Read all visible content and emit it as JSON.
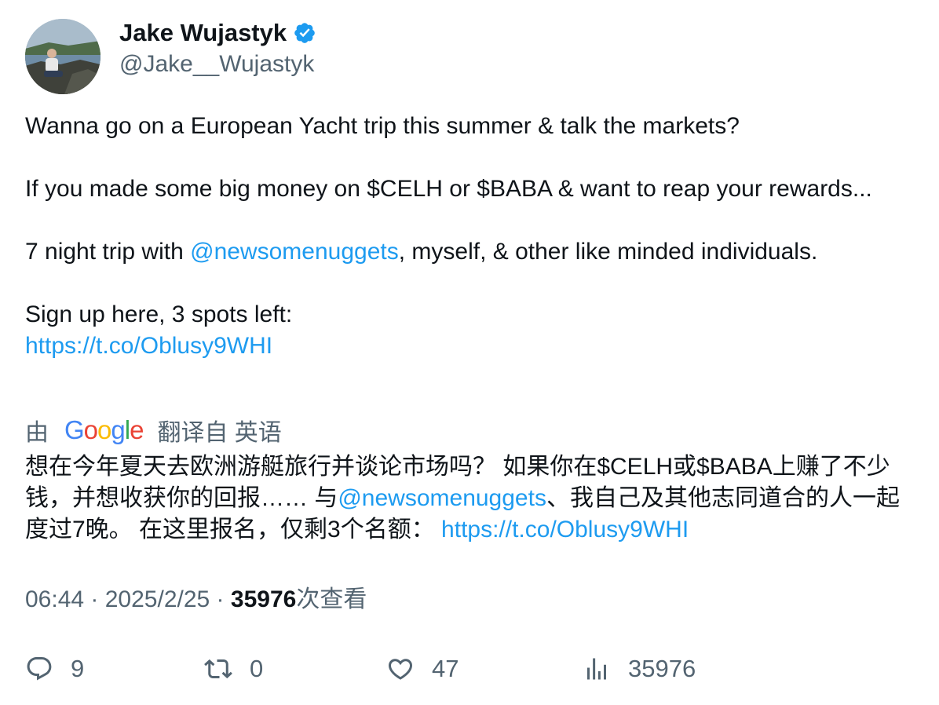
{
  "user": {
    "display_name": "Jake Wujastyk",
    "handle": "@Jake__Wujastyk",
    "verified": true
  },
  "tweet": {
    "line1": "Wanna go on a European Yacht trip this summer & talk the markets?",
    "line2": "If you made some big money on $CELH or $BABA & want to reap your rewards...",
    "line3_prefix": "7 night trip with ",
    "mention": "@newsomenuggets",
    "line3_suffix": ", myself, & other like minded individuals.",
    "line4": "Sign up here, 3 spots left:",
    "link": "https://t.co/Oblusy9WHI"
  },
  "translation": {
    "by_label": "由",
    "provider": "Google",
    "from_label": "翻译自 英语",
    "part1": "想在今年夏天去欧洲游艇旅行并谈论市场吗？ 如果你在$CELH或$BABA上赚了不少钱，并想收获你的回报…… 与",
    "mention": "@newsomenuggets",
    "part2": "、我自己及其他志同道合的人一起度过7晚。 在这里报名，仅剩3个名额： ",
    "link": "https://t.co/Oblusy9WHI"
  },
  "meta": {
    "time": "06:44",
    "sep1": " · ",
    "date": "2025/2/25",
    "sep2": " · ",
    "views_count": "35976",
    "views_label": "次查看"
  },
  "actions": {
    "replies": "9",
    "retweets": "0",
    "likes": "47",
    "views": "35976"
  },
  "colors": {
    "link": "#1d9bf0",
    "secondary_text": "#536471",
    "primary_text": "#0f1419",
    "verified_badge": "#1d9bf0"
  },
  "icons": [
    "verified-badge-icon",
    "reply-icon",
    "retweet-icon",
    "like-icon",
    "views-icon"
  ]
}
